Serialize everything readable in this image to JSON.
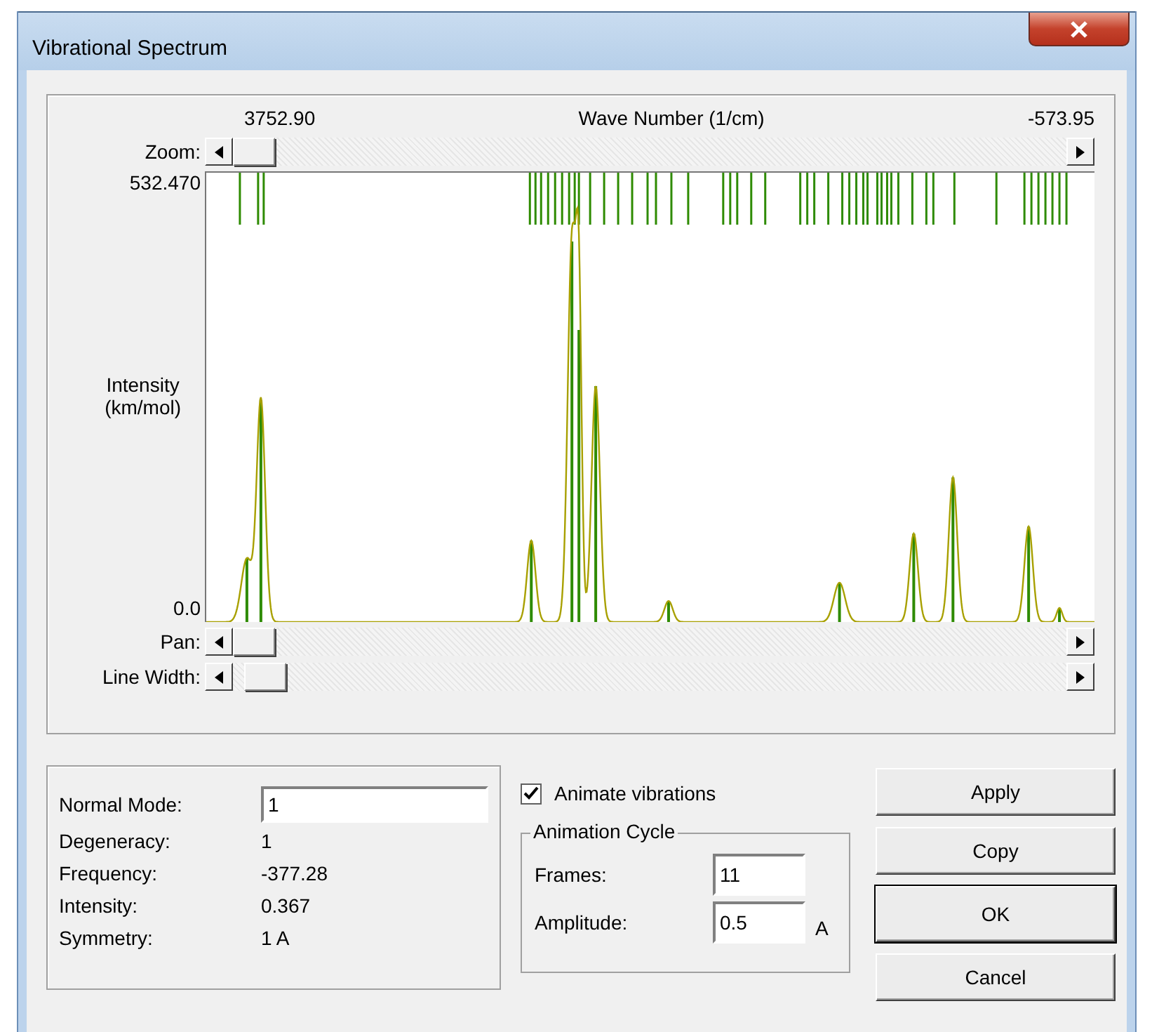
{
  "window": {
    "title": "Vibrational Spectrum"
  },
  "spectrum": {
    "x_start": "3752.90",
    "x_title": "Wave Number (1/cm)",
    "x_end": "-573.95",
    "y_max": "532.470",
    "y_label": "Intensity\n(km/mol)",
    "y_min": "0.0"
  },
  "sliders": [
    {
      "label": "Zoom:",
      "level": 0
    },
    {
      "label": "Pan:",
      "level": 0
    },
    {
      "label": "Line Width:",
      "level": 0.015
    }
  ],
  "mode_info": [
    {
      "label": "Normal Mode:",
      "kind": "input",
      "value": "1"
    },
    {
      "label": "Degeneracy:",
      "kind": "text",
      "value": "1"
    },
    {
      "label": "Frequency:",
      "kind": "text",
      "value": "-377.28"
    },
    {
      "label": "Intensity:",
      "kind": "text",
      "value": "0.367"
    },
    {
      "label": "Symmetry:",
      "kind": "text",
      "value": "1 A"
    }
  ],
  "animate": {
    "label": "Animate vibrations",
    "checked": true
  },
  "animation_cycle": {
    "title": "Animation Cycle",
    "frames": {
      "label": "Frames:",
      "value": "11"
    },
    "amplitude": {
      "label": "Amplitude:",
      "value": "0.5",
      "unit": "A"
    }
  },
  "buttons": [
    {
      "label": "Apply",
      "default": false
    },
    {
      "label": "Copy",
      "default": false
    },
    {
      "label": "OK",
      "default": true
    },
    {
      "label": "Cancel",
      "default": false
    }
  ]
}
